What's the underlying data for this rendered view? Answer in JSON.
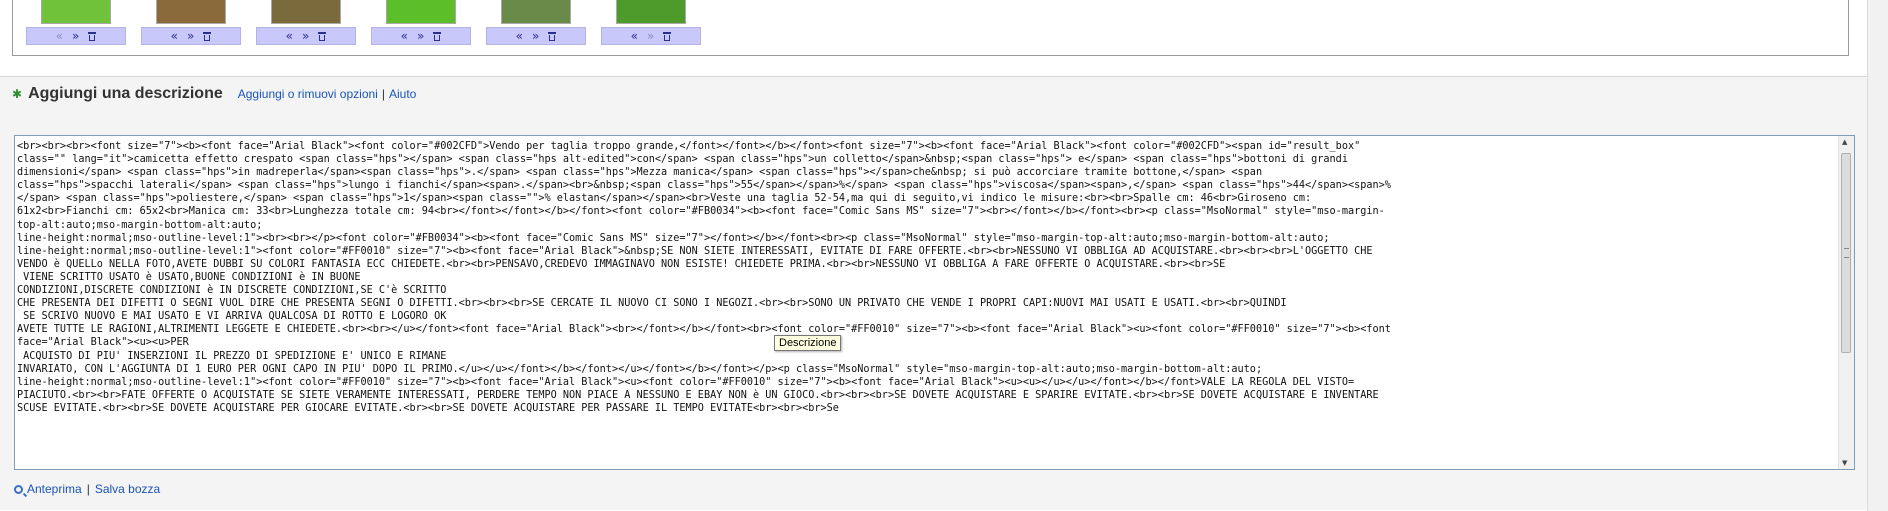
{
  "gallery": {
    "thumbnails": [
      {
        "color": "#6fc23a",
        "controls": [
          "«",
          "»",
          "trash"
        ],
        "first_disabled": true
      },
      {
        "color": "#8a6a3a",
        "controls": [
          "«",
          "»",
          "trash"
        ],
        "first_disabled": false
      },
      {
        "color": "#7b6a3b",
        "controls": [
          "«",
          "»",
          "trash"
        ],
        "first_disabled": false
      },
      {
        "color": "#5cbf2a",
        "controls": [
          "«",
          "»",
          "trash"
        ],
        "first_disabled": false
      },
      {
        "color": "#6a8a4a",
        "controls": [
          "«",
          "»",
          "trash"
        ],
        "first_disabled": false
      },
      {
        "color": "#4e9a2a",
        "controls": [
          "«",
          "»",
          "trash"
        ],
        "last_disabled": true
      }
    ],
    "move_left_label": "«",
    "move_right_label": "»"
  },
  "section": {
    "title": "Aggiungi una descrizione",
    "link_options": "Aggiungi o rimuovi opzioni",
    "link_help": "Aiuto"
  },
  "editor": {
    "lines": [
      "<br><br><br><font size=\"7\"><b><font face=\"Arial Black\"><font color=\"#002CFD\">Vendo per taglia troppo grande,</font></font></b></font><font size=\"7\"><b><font face=\"Arial Black\"><font color=\"#002CFD\"><span id=\"result_box\"",
      "class=\"\" lang=\"it\">camicetta effetto crespato <span class=\"hps\"></span> <span class=\"hps alt-edited\">con</span> <span class=\"hps\">un colletto</span>&nbsp;<span class=\"hps\"> e</span> <span class=\"hps\">bottoni di grandi",
      "dimensioni</span> <span class=\"hps\">in madreperla</span><span class=\"hps\">.</span> <span class=\"hps\">Mezza manica</span> <span class=\"hps\"></span>che&nbsp; si può accorciare tramite bottone,</span> <span",
      "class=\"hps\">spacchi laterali</span> <span class=\"hps\">lungo i fianchi</span><span>.</span><br>&nbsp;<span class=\"hps\">55</span></span>%</span> <span class=\"hps\">viscosa</span><span>,</span> <span class=\"hps\">44</span><span>%",
      "</span> <span class=\"hps\">poliestere,</span> <span class=\"hps\">1</span><span class=\"\">% elastan</span></span><br>Veste una taglia 52-54,ma qui di seguito,vi indico le misure:<br><br>Spalle cm: 46<br>Giroseno cm:",
      "61x2<br>Fianchi cm: 65x2<br>Manica cm: 33<br>Lunghezza totale cm: 94<br></font></font></b></font><font color=\"#FB0034\"><b><font face=\"Comic Sans MS\" size=\"7\"><br></font></b></font><br><p class=\"MsoNormal\" style=\"mso-margin-",
      "top-alt:auto;mso-margin-bottom-alt:auto;",
      "line-height:normal;mso-outline-level:1\"><br><br></p><font color=\"#FB0034\"><b><font face=\"Comic Sans MS\" size=\"7\"></font></b></font><br><p class=\"MsoNormal\" style=\"mso-margin-top-alt:auto;mso-margin-bottom-alt:auto;",
      "line-height:normal;mso-outline-level:1\"><font color=\"#FF0010\" size=\"7\"><b><font face=\"Arial Black\">&nbsp;SE NON SIETE INTERESSATI, EVITATE DI FARE OFFERTE.<br><br>NESSUNO VI OBBLIGA AD ACQUISTARE.<br><br><br>L'OGGETTO CHE",
      "VENDO è QUELLo NELLA FOTO,AVETE DUBBI SU COLORI FANTASIA ECC CHIEDETE.<br><br>PENSAVO,CREDEVO IMMAGINAVO NON ESISTE! CHIEDETE PRIMA.<br><br>NESSUNO VI OBBLIGA A FARE OFFERTE O ACQUISTARE.<br><br>SE",
      " VIENE SCRITTO USATO è USATO,BUONE CONDIZIONI è IN BUONE",
      "CONDIZIONI,DISCRETE CONDIZIONI è IN DISCRETE CONDIZIONI,SE C'è SCRITTO",
      "CHE PRESENTA DEI DIFETTI O SEGNI VUOL DIRE CHE PRESENTA SEGNI O DIFETTI.<br><br><br>SE CERCATE IL NUOVO CI SONO I NEGOZI.<br><br>SONO UN PRIVATO CHE VENDE I PROPRI CAPI:NUOVI MAI USATI E USATI.<br><br>QUINDI",
      " SE SCRIVO NUOVO E MAI USATO E VI ARRIVA QUALCOSA DI ROTTO E LOGORO OK",
      "AVETE TUTTE LE RAGIONI,ALTRIMENTI LEGGETE E CHIEDETE.<br><br></u></font><font face=\"Arial Black\"><br></font></b></font><br><font color=\"#FF0010\" size=\"7\"><b><font face=\"Arial Black\"><u><font color=\"#FF0010\" size=\"7\"><b><font",
      "face=\"Arial Black\"><u><u>PER",
      " ACQUISTO DI PIU' INSERZIONI IL PREZZO DI SPEDIZIONE E' UNICO E RIMANE",
      "INVARIATO, CON L'AGGIUNTA DI 1 EURO PER OGNI CAPO IN PIU' DOPO IL PRIMO.</u></u></font></b></font></u></font></b></font></p><p class=\"MsoNormal\" style=\"mso-margin-top-alt:auto;mso-margin-bottom-alt:auto;",
      "line-height:normal;mso-outline-level:1\"><font color=\"#FF0010\" size=\"7\"><b><font face=\"Arial Black\"><u><font color=\"#FF0010\" size=\"7\"><b><font face=\"Arial Black\"><u><u></u></u></font></b></font>VALE LA REGOLA DEL VISTO=",
      "PIACIUTO.<br><br>FATE OFFERTE O ACQUISTATE SE SIETE VERAMENTE INTERESSATI, PERDERE TEMPO NON PIACE A NESSUNO E EBAY NON è UN GIOCO.<br><br><br>SE DOVETE ACQUISTARE E SPARIRE EVITATE.<br><br>SE DOVETE ACQUISTARE E INVENTARE",
      "SCUSE EVITATE.<br><br>SE DOVETE ACQUISTARE PER GIOCARE EVITATE.<br><br>SE DOVETE ACQUISTARE PER PASSARE IL TEMPO EVITATE<br><br><br>Se"
    ]
  },
  "tooltip": {
    "text": "Descrizione"
  },
  "footer": {
    "preview_label": "Anteprima",
    "save_draft_label": "Salva bozza"
  }
}
